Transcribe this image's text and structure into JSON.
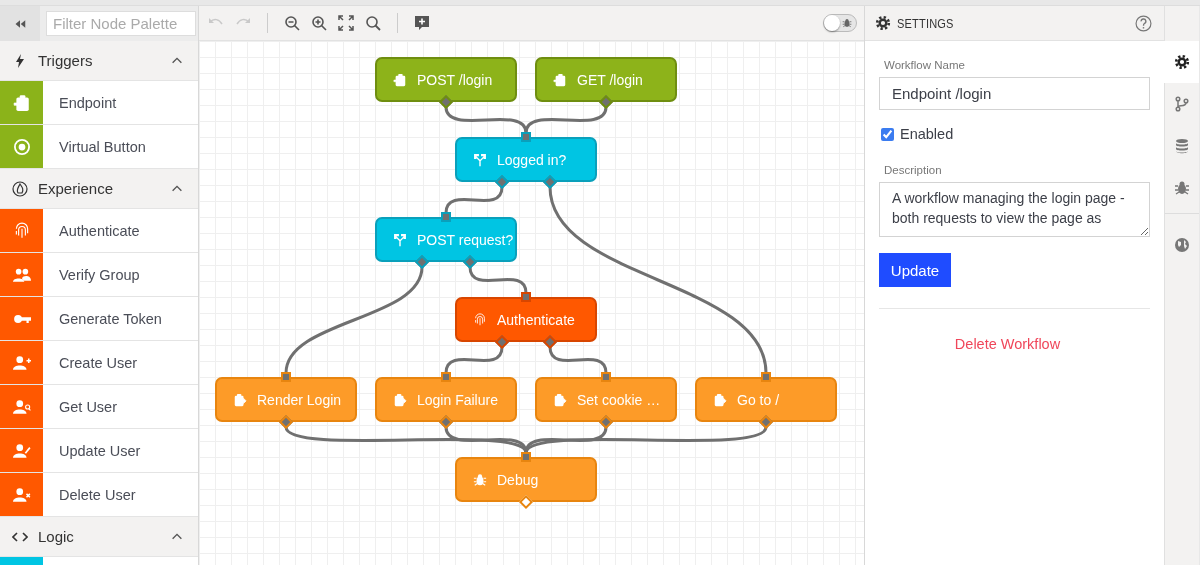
{
  "palette": {
    "filter": {
      "placeholder": "Filter Node Palette"
    },
    "sections": [
      {
        "title": "Triggers",
        "kind": "triggers",
        "expanded": true,
        "items": [
          {
            "label": "Endpoint",
            "kind": "endpoint"
          },
          {
            "label": "Virtual Button",
            "kind": "virtual-button"
          }
        ]
      },
      {
        "title": "Experience",
        "kind": "experience",
        "expanded": true,
        "items": [
          {
            "label": "Authenticate",
            "kind": "authenticate"
          },
          {
            "label": "Verify Group",
            "kind": "verify-group"
          },
          {
            "label": "Generate Token",
            "kind": "generate-token"
          },
          {
            "label": "Create User",
            "kind": "create-user"
          },
          {
            "label": "Get User",
            "kind": "get-user"
          },
          {
            "label": "Update User",
            "kind": "update-user"
          },
          {
            "label": "Delete User",
            "kind": "delete-user"
          }
        ]
      },
      {
        "title": "Logic",
        "kind": "logic",
        "expanded": true,
        "items": [
          {
            "kind": "conditional"
          }
        ]
      }
    ]
  },
  "toolbar": [
    {
      "kind": "undo",
      "disabled": true
    },
    {
      "kind": "redo",
      "disabled": true
    },
    {
      "kind": "zoom-out",
      "disabled": false
    },
    {
      "kind": "zoom-in",
      "disabled": false
    },
    {
      "kind": "fit",
      "disabled": false
    },
    {
      "kind": "zoom-reset",
      "disabled": false
    },
    {
      "kind": "add-comment",
      "disabled": false
    }
  ],
  "debug_toggle": {
    "on": false
  },
  "nodes": [
    {
      "label": "POST /login",
      "kind": "endpoint",
      "outputs": [
        {
          "connected": true
        }
      ]
    },
    {
      "label": "GET /login",
      "kind": "endpoint",
      "outputs": [
        {
          "connected": true
        }
      ]
    },
    {
      "label": "Logged in?",
      "kind": "conditional",
      "outputs": [
        {
          "connected": true
        },
        {
          "connected": true
        }
      ]
    },
    {
      "label": "POST request?",
      "kind": "conditional",
      "outputs": [
        {
          "connected": true
        },
        {
          "connected": true
        }
      ]
    },
    {
      "label": "Authenticate",
      "kind": "authenticate",
      "outputs": [
        {
          "connected": true
        },
        {
          "connected": true
        }
      ]
    },
    {
      "label": "Render Login",
      "kind": "output",
      "outputs": [
        {
          "connected": true
        }
      ]
    },
    {
      "label": "Login Failure",
      "kind": "output",
      "outputs": [
        {
          "connected": true
        }
      ]
    },
    {
      "label": "Set cookie …",
      "kind": "output",
      "outputs": [
        {
          "connected": true
        }
      ]
    },
    {
      "label": "Go to /",
      "kind": "output",
      "outputs": [
        {
          "connected": true
        }
      ]
    },
    {
      "label": "Debug",
      "kind": "debug",
      "outputs": [
        {
          "connected": false
        }
      ]
    }
  ],
  "settings": {
    "title": "SETTINGS",
    "workflow_name": {
      "label": "Workflow Name",
      "value": "Endpoint /login"
    },
    "enabled": {
      "label": "Enabled",
      "checked": true
    },
    "description": {
      "label": "Description",
      "value": "A workflow managing the login page - both requests to view the page as"
    },
    "update_button": "Update",
    "delete_link": "Delete Workflow"
  },
  "rail_tabs": [
    {
      "kind": "settings",
      "selected": true
    },
    {
      "kind": "versions",
      "selected": false
    },
    {
      "kind": "storage",
      "selected": false
    },
    {
      "kind": "debug",
      "selected": false
    },
    {
      "kind": "globe",
      "selected": false
    }
  ]
}
